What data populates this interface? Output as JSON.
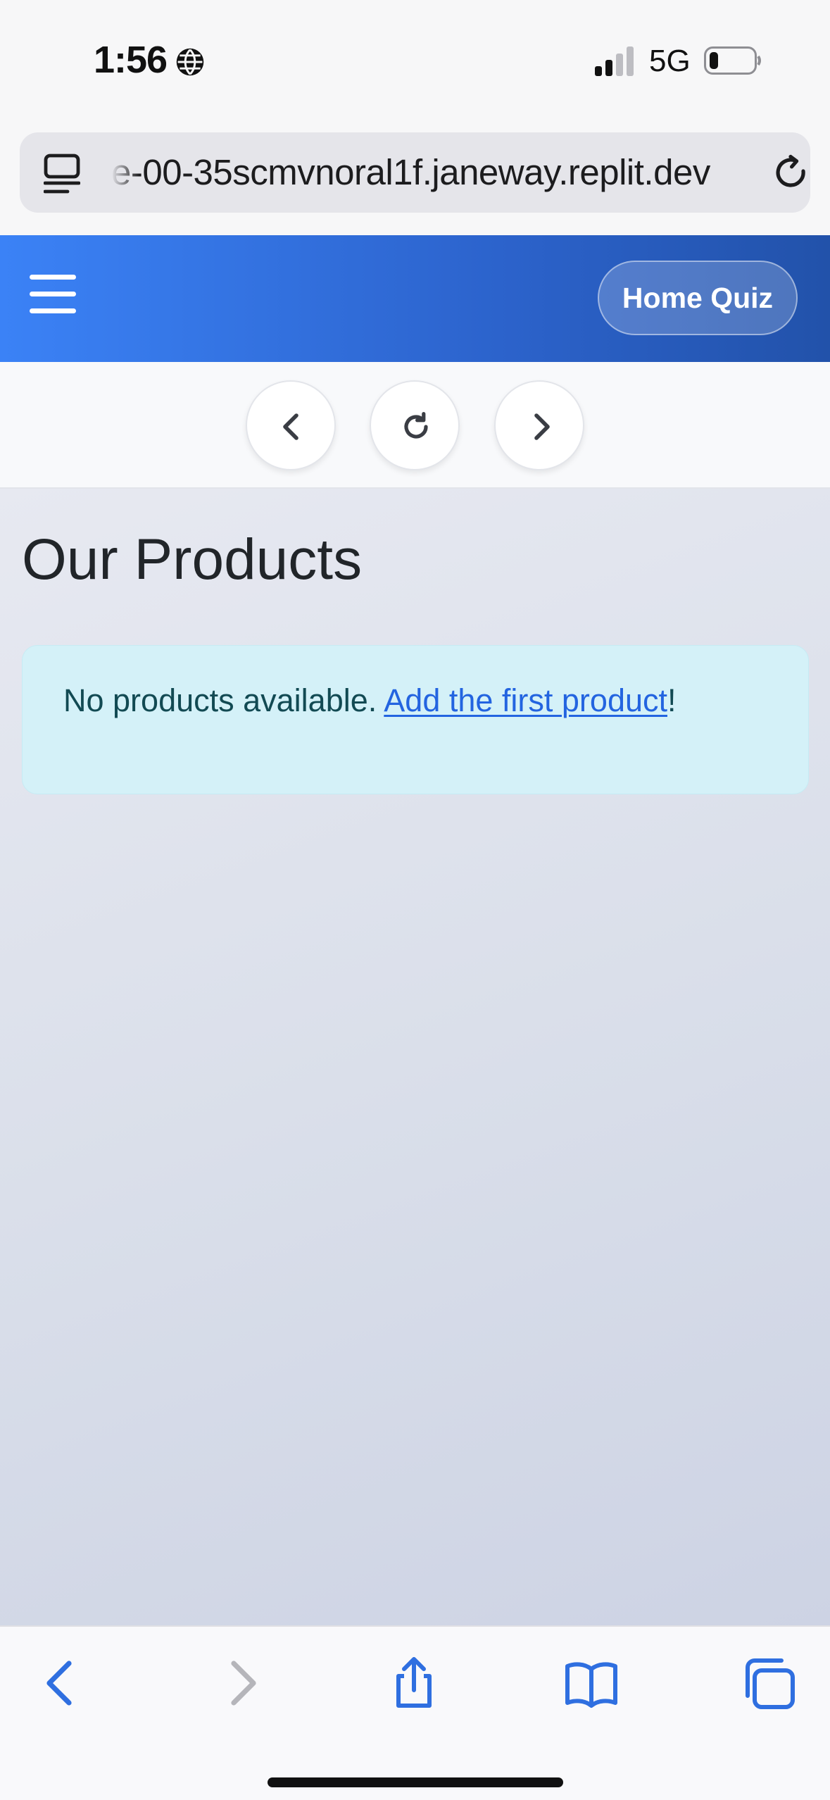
{
  "status_bar": {
    "time": "1:56",
    "network": "5G"
  },
  "browser": {
    "url": "e-00-35scmvnoral1f.janeway.replit.dev"
  },
  "navbar": {
    "home_quiz_label": "Home Quiz"
  },
  "main": {
    "title": "Our Products",
    "alert": {
      "text": "No products available. ",
      "link_label": "Add the first product",
      "suffix": "!"
    }
  },
  "colors": {
    "navbar_start": "#3b82f6",
    "navbar_end": "#2252aa",
    "alert_bg": "#d4f1f8",
    "link": "#2364e0",
    "safari_blue": "#2f6fe0"
  },
  "icons": [
    "globe-icon",
    "signal-icon",
    "battery-icon",
    "reader-icon",
    "reload-icon",
    "menu-icon",
    "chevron-left-icon",
    "refresh-icon",
    "chevron-right-icon",
    "share-icon",
    "bookmarks-icon",
    "tabs-icon"
  ]
}
